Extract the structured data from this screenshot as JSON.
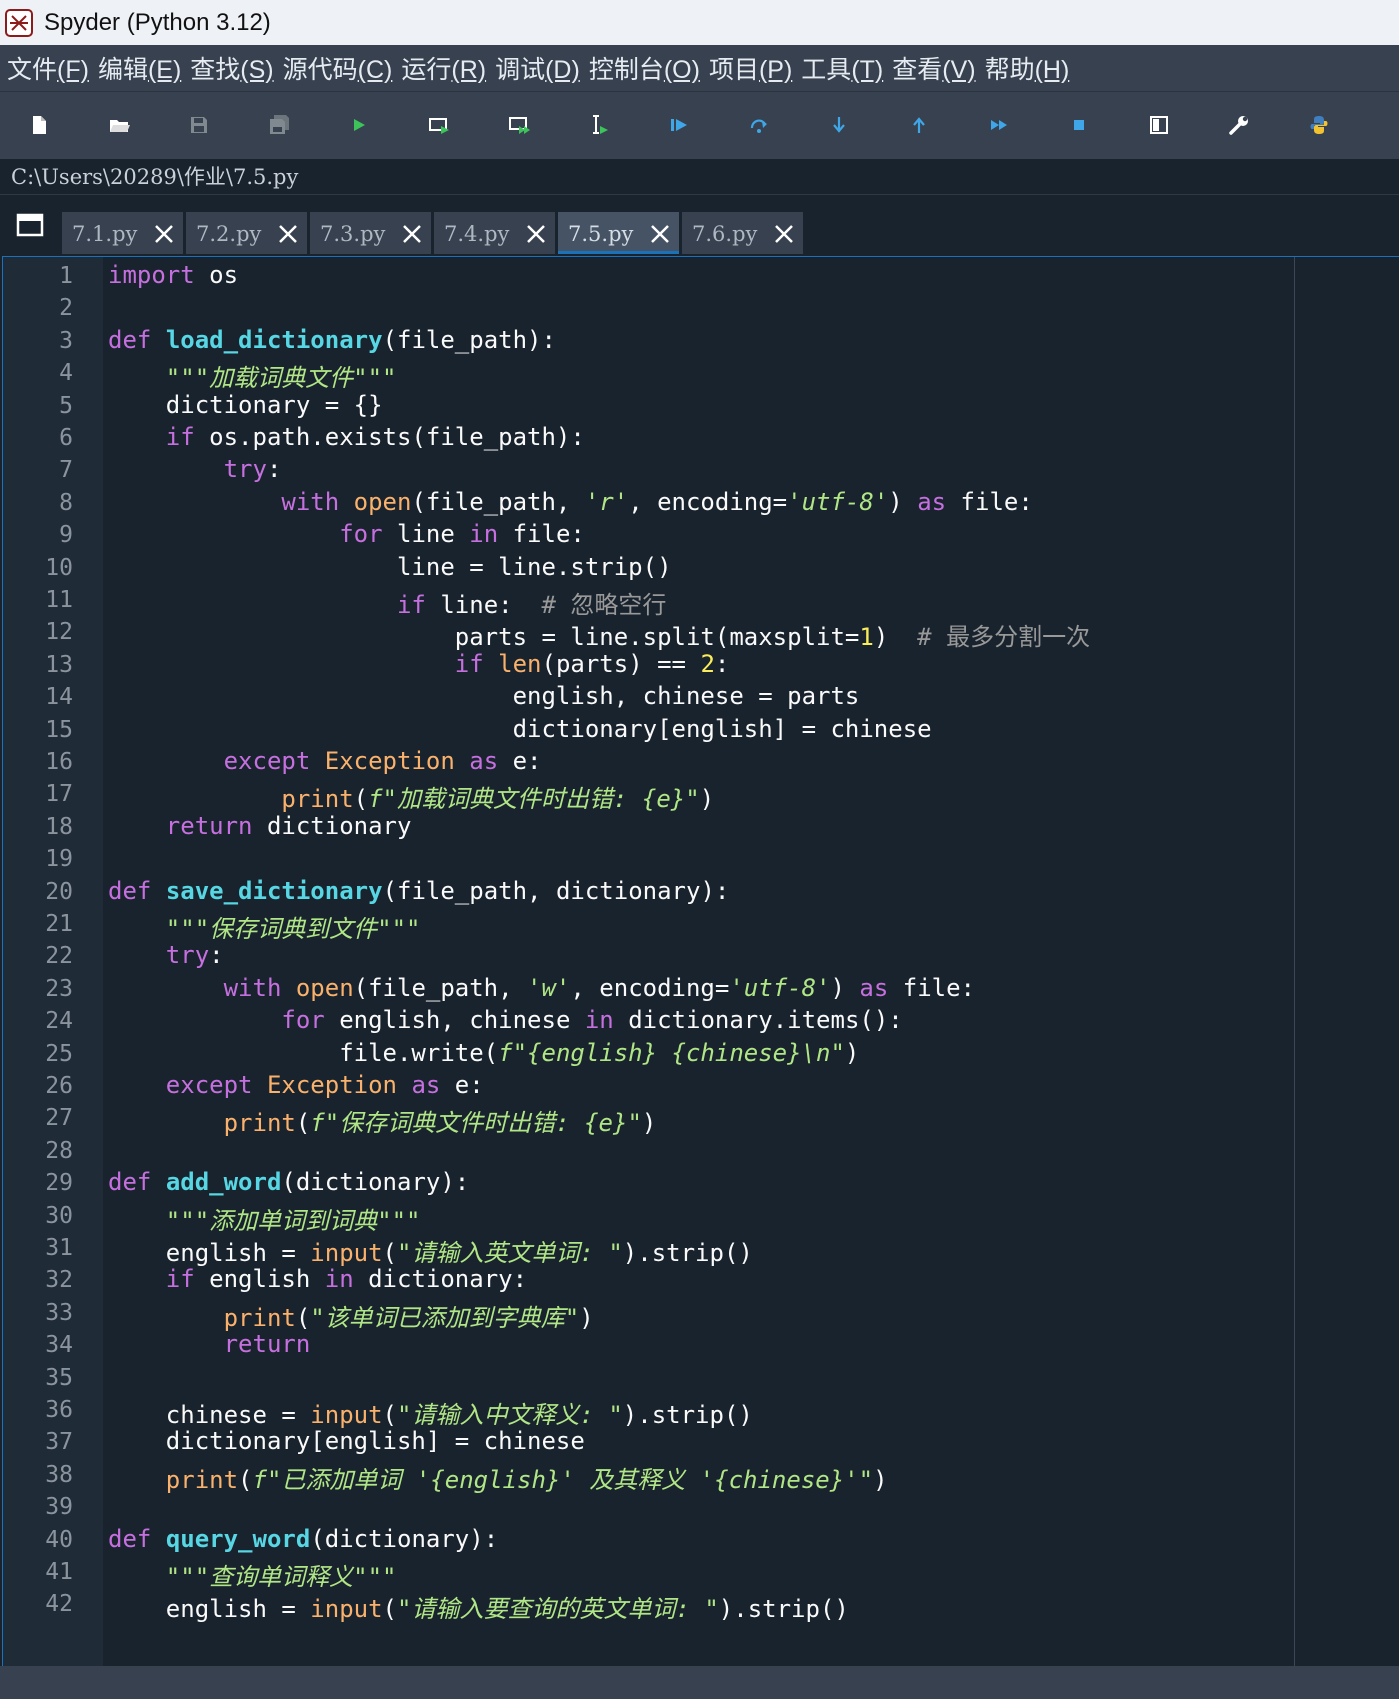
{
  "window": {
    "title": "Spyder (Python 3.12)"
  },
  "menu": [
    {
      "label": "文件",
      "mnemonic": "(F)"
    },
    {
      "label": "编辑",
      "mnemonic": "(E)"
    },
    {
      "label": "查找",
      "mnemonic": "(S)"
    },
    {
      "label": "源代码",
      "mnemonic": "(C)"
    },
    {
      "label": "运行",
      "mnemonic": "(R)"
    },
    {
      "label": "调试",
      "mnemonic": "(D)"
    },
    {
      "label": "控制台",
      "mnemonic": "(O)"
    },
    {
      "label": "项目",
      "mnemonic": "(P)"
    },
    {
      "label": "工具",
      "mnemonic": "(T)"
    },
    {
      "label": "查看",
      "mnemonic": "(V)"
    },
    {
      "label": "帮助",
      "mnemonic": "(H)"
    }
  ],
  "toolbar": {
    "buttons": [
      "new-file",
      "open-file",
      "save-file",
      "save-all",
      "run",
      "run-cell",
      "run-cell-advance",
      "run-selection",
      "debug",
      "step",
      "step-into",
      "step-return",
      "continue",
      "stop",
      "maximize-pane",
      "preferences",
      "python-path"
    ],
    "colors": {
      "accent_blue": "#3fa6e8",
      "accent_green": "#3cc45a",
      "icon_white": "#ffffff",
      "icon_gray": "#808890"
    }
  },
  "path": "C:\\Users\\20289\\作业\\7.5.py",
  "tabs": [
    {
      "label": "7.1.py",
      "active": false
    },
    {
      "label": "7.2.py",
      "active": false
    },
    {
      "label": "7.3.py",
      "active": false
    },
    {
      "label": "7.4.py",
      "active": false
    },
    {
      "label": "7.5.py",
      "active": true
    },
    {
      "label": "7.6.py",
      "active": false
    }
  ],
  "code": [
    [
      [
        "k",
        "import"
      ],
      [
        "p",
        " os"
      ]
    ],
    [],
    [
      [
        "k",
        "def"
      ],
      [
        "p",
        " "
      ],
      [
        "df",
        "load_dictionary"
      ],
      [
        "p",
        "(file_path):"
      ]
    ],
    [
      [
        "p",
        "    "
      ],
      [
        "s",
        "\"\"\"加载词典文件\"\"\""
      ]
    ],
    [
      [
        "p",
        "    dictionary = {}"
      ]
    ],
    [
      [
        "p",
        "    "
      ],
      [
        "k",
        "if"
      ],
      [
        "p",
        " os.path.exists(file_path):"
      ]
    ],
    [
      [
        "p",
        "        "
      ],
      [
        "k",
        "try"
      ],
      [
        "p",
        ":"
      ]
    ],
    [
      [
        "p",
        "            "
      ],
      [
        "k",
        "with"
      ],
      [
        "p",
        " "
      ],
      [
        "b",
        "open"
      ],
      [
        "p",
        "(file_path, "
      ],
      [
        "s",
        "'r'"
      ],
      [
        "p",
        ", encoding="
      ],
      [
        "s",
        "'utf-8'"
      ],
      [
        "p",
        ") "
      ],
      [
        "k",
        "as"
      ],
      [
        "p",
        " file:"
      ]
    ],
    [
      [
        "p",
        "                "
      ],
      [
        "k",
        "for"
      ],
      [
        "p",
        " line "
      ],
      [
        "k",
        "in"
      ],
      [
        "p",
        " file:"
      ]
    ],
    [
      [
        "p",
        "                    line = line.strip()"
      ]
    ],
    [
      [
        "p",
        "                    "
      ],
      [
        "k",
        "if"
      ],
      [
        "p",
        " line:  "
      ],
      [
        "c",
        "# 忽略空行"
      ]
    ],
    [
      [
        "p",
        "                        parts = line.split(maxsplit="
      ],
      [
        "n",
        "1"
      ],
      [
        "p",
        ")  "
      ],
      [
        "c",
        "# 最多分割一次"
      ]
    ],
    [
      [
        "p",
        "                        "
      ],
      [
        "k",
        "if"
      ],
      [
        "p",
        " "
      ],
      [
        "b",
        "len"
      ],
      [
        "p",
        "(parts) == "
      ],
      [
        "n",
        "2"
      ],
      [
        "p",
        ":"
      ]
    ],
    [
      [
        "p",
        "                            english, chinese = parts"
      ]
    ],
    [
      [
        "p",
        "                            dictionary[english] = chinese"
      ]
    ],
    [
      [
        "p",
        "        "
      ],
      [
        "k",
        "except"
      ],
      [
        "p",
        " "
      ],
      [
        "b",
        "Exception"
      ],
      [
        "p",
        " "
      ],
      [
        "k",
        "as"
      ],
      [
        "p",
        " e:"
      ]
    ],
    [
      [
        "p",
        "            "
      ],
      [
        "b",
        "print"
      ],
      [
        "p",
        "("
      ],
      [
        "s",
        "f\"加载词典文件时出错: {e}\""
      ],
      [
        "p",
        ")"
      ]
    ],
    [
      [
        "p",
        "    "
      ],
      [
        "k",
        "return"
      ],
      [
        "p",
        " dictionary"
      ]
    ],
    [],
    [
      [
        "k",
        "def"
      ],
      [
        "p",
        " "
      ],
      [
        "df",
        "save_dictionary"
      ],
      [
        "p",
        "(file_path, dictionary):"
      ]
    ],
    [
      [
        "p",
        "    "
      ],
      [
        "s",
        "\"\"\"保存词典到文件\"\"\""
      ]
    ],
    [
      [
        "p",
        "    "
      ],
      [
        "k",
        "try"
      ],
      [
        "p",
        ":"
      ]
    ],
    [
      [
        "p",
        "        "
      ],
      [
        "k",
        "with"
      ],
      [
        "p",
        " "
      ],
      [
        "b",
        "open"
      ],
      [
        "p",
        "(file_path, "
      ],
      [
        "s",
        "'w'"
      ],
      [
        "p",
        ", encoding="
      ],
      [
        "s",
        "'utf-8'"
      ],
      [
        "p",
        ") "
      ],
      [
        "k",
        "as"
      ],
      [
        "p",
        " file:"
      ]
    ],
    [
      [
        "p",
        "            "
      ],
      [
        "k",
        "for"
      ],
      [
        "p",
        " english, chinese "
      ],
      [
        "k",
        "in"
      ],
      [
        "p",
        " dictionary.items():"
      ]
    ],
    [
      [
        "p",
        "                file.write("
      ],
      [
        "s",
        "f\"{english} {chinese}\\n\""
      ],
      [
        "p",
        ")"
      ]
    ],
    [
      [
        "p",
        "    "
      ],
      [
        "k",
        "except"
      ],
      [
        "p",
        " "
      ],
      [
        "b",
        "Exception"
      ],
      [
        "p",
        " "
      ],
      [
        "k",
        "as"
      ],
      [
        "p",
        " e:"
      ]
    ],
    [
      [
        "p",
        "        "
      ],
      [
        "b",
        "print"
      ],
      [
        "p",
        "("
      ],
      [
        "s",
        "f\"保存词典文件时出错: {e}\""
      ],
      [
        "p",
        ")"
      ]
    ],
    [],
    [
      [
        "k",
        "def"
      ],
      [
        "p",
        " "
      ],
      [
        "df",
        "add_word"
      ],
      [
        "p",
        "(dictionary):"
      ]
    ],
    [
      [
        "p",
        "    "
      ],
      [
        "s",
        "\"\"\"添加单词到词典\"\"\""
      ]
    ],
    [
      [
        "p",
        "    english = "
      ],
      [
        "b",
        "input"
      ],
      [
        "p",
        "("
      ],
      [
        "s",
        "\"请输入英文单词: \""
      ],
      [
        "p",
        ").strip()"
      ]
    ],
    [
      [
        "p",
        "    "
      ],
      [
        "k",
        "if"
      ],
      [
        "p",
        " english "
      ],
      [
        "k",
        "in"
      ],
      [
        "p",
        " dictionary:"
      ]
    ],
    [
      [
        "p",
        "        "
      ],
      [
        "b",
        "print"
      ],
      [
        "p",
        "("
      ],
      [
        "s",
        "\"该单词已添加到字典库\""
      ],
      [
        "p",
        ")"
      ]
    ],
    [
      [
        "p",
        "        "
      ],
      [
        "k",
        "return"
      ]
    ],
    [],
    [
      [
        "p",
        "    chinese = "
      ],
      [
        "b",
        "input"
      ],
      [
        "p",
        "("
      ],
      [
        "s",
        "\"请输入中文释义: \""
      ],
      [
        "p",
        ").strip()"
      ]
    ],
    [
      [
        "p",
        "    dictionary[english] = chinese"
      ]
    ],
    [
      [
        "p",
        "    "
      ],
      [
        "b",
        "print"
      ],
      [
        "p",
        "("
      ],
      [
        "s",
        "f\"已添加单词 '{english}' 及其释义 '{chinese}'\""
      ],
      [
        "p",
        ")"
      ]
    ],
    [],
    [
      [
        "k",
        "def"
      ],
      [
        "p",
        " "
      ],
      [
        "df",
        "query_word"
      ],
      [
        "p",
        "(dictionary):"
      ]
    ],
    [
      [
        "p",
        "    "
      ],
      [
        "s",
        "\"\"\"查询单词释义\"\"\""
      ]
    ],
    [
      [
        "p",
        "    english = "
      ],
      [
        "b",
        "input"
      ],
      [
        "p",
        "("
      ],
      [
        "s",
        "\"请输入要查询的英文单词: \""
      ],
      [
        "p",
        ").strip()"
      ]
    ]
  ]
}
